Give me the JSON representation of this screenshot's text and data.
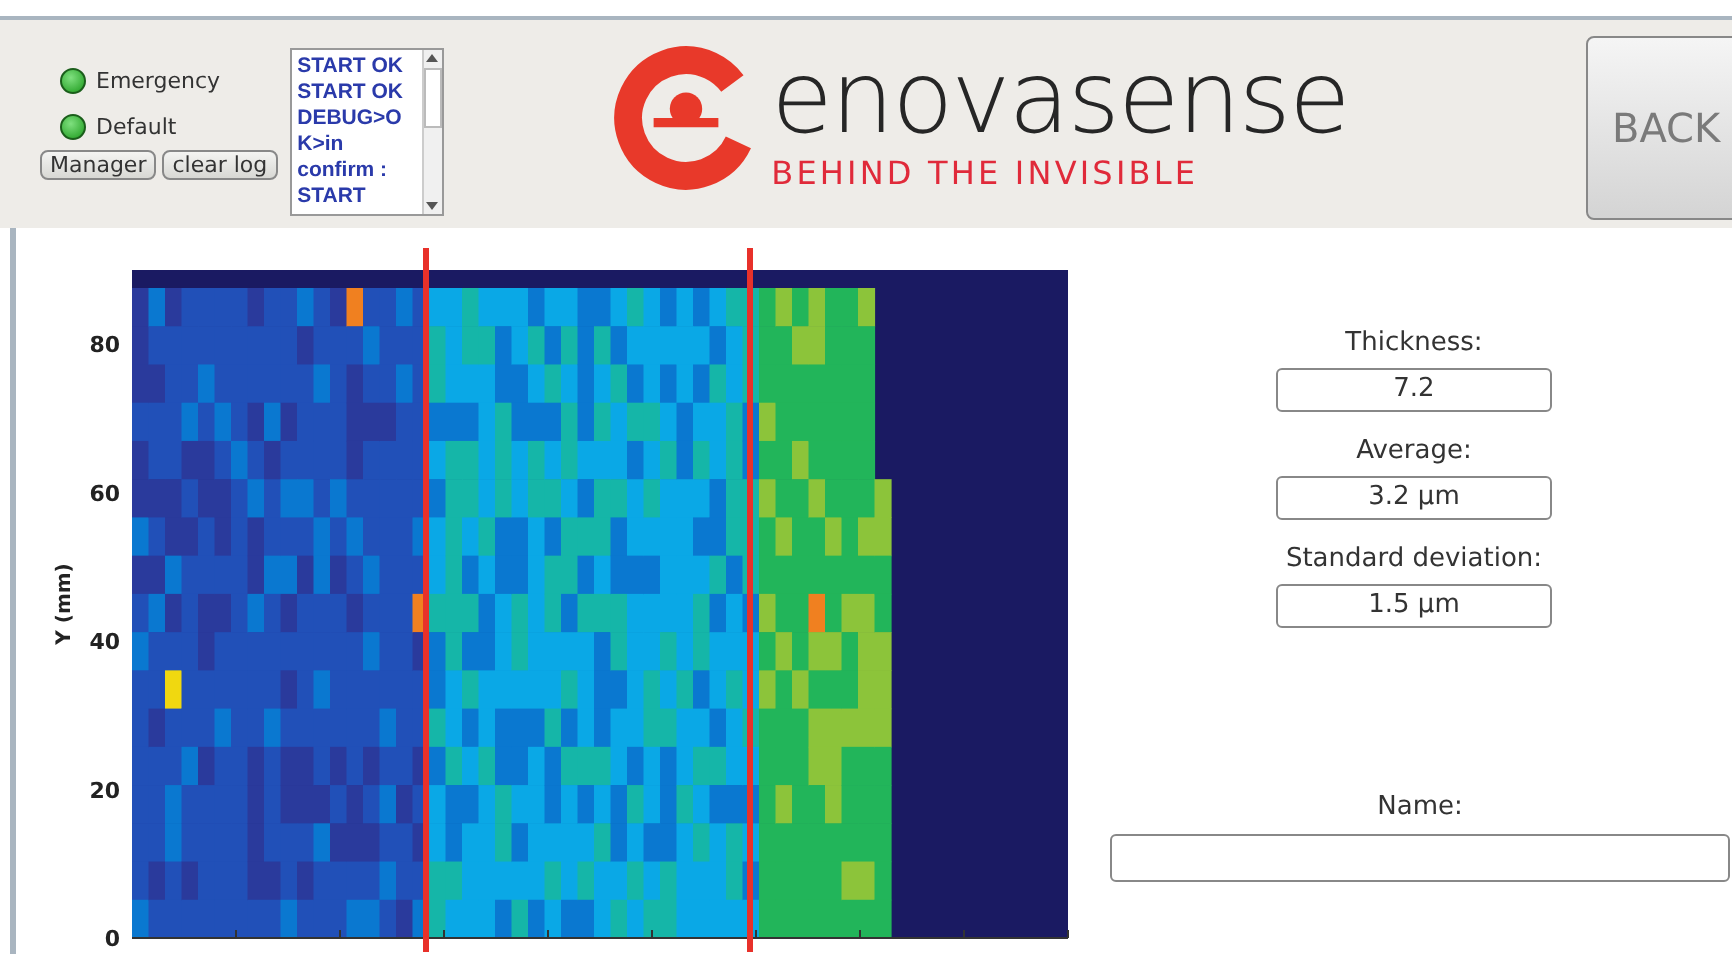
{
  "header": {
    "indicators": [
      {
        "label": "Emergency",
        "on": true
      },
      {
        "label": "Default",
        "on": true
      }
    ],
    "buttons": [
      "Manager",
      "clear log"
    ],
    "log": [
      "START OK",
      "START OK",
      "DEBUG>O",
      "K>in",
      "confirm :",
      "START"
    ],
    "logo": {
      "name": "enovasense",
      "tagline": "BEHIND THE INVISIBLE"
    },
    "back_button": "BACK"
  },
  "plot": {
    "ylabel": "Y (mm)",
    "yticks": [
      "80",
      "60",
      "40",
      "20",
      "0"
    ]
  },
  "fields": [
    {
      "label": "Thickness:",
      "value": "7.2"
    },
    {
      "label": "Average:",
      "value": "3.2 µm"
    },
    {
      "label": "Standard deviation:",
      "value": "1.5 µm"
    }
  ],
  "name_field": {
    "label": "Name:"
  }
}
